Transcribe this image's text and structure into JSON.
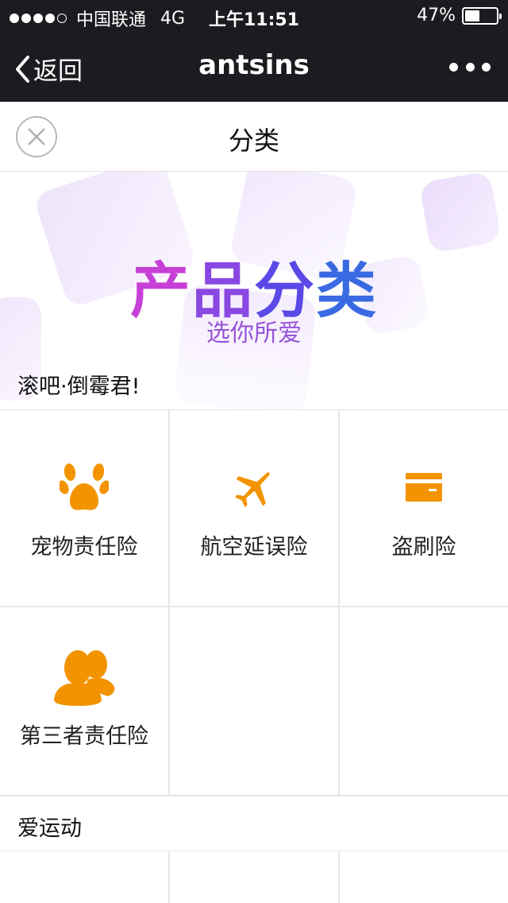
{
  "status_bar": {
    "carrier": "中国联通",
    "network": "4G",
    "time": "上午11:51",
    "battery_text": "47%",
    "battery_level": 0.47,
    "signal_bars": 4
  },
  "nav": {
    "back_label": "返回",
    "title": "antsins"
  },
  "header": {
    "title": "分类"
  },
  "banner": {
    "title_chars": [
      "产",
      "品",
      "分",
      "类"
    ],
    "subtitle": "选你所爱"
  },
  "sections": [
    {
      "title": "滚吧·倒霉君!",
      "items": [
        {
          "label": "宠物责任险",
          "icon": "paw-icon"
        },
        {
          "label": "航空延误险",
          "icon": "airplane-icon"
        },
        {
          "label": "盗刷险",
          "icon": "credit-card-icon"
        },
        {
          "label": "第三者责任险",
          "icon": "users-icon"
        }
      ]
    },
    {
      "title": "爱运动",
      "items": []
    }
  ],
  "colors": {
    "nav_bg": "#1c1b20",
    "icon_orange": "#f39300",
    "banner_purple": "#9654d6"
  }
}
